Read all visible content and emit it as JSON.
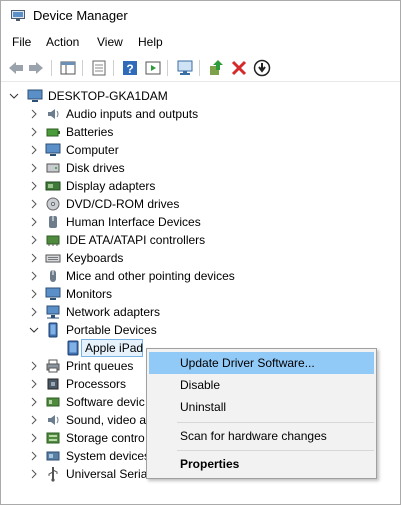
{
  "window": {
    "title": "Device Manager"
  },
  "menu": [
    "File",
    "Action",
    "View",
    "Help"
  ],
  "toolbar": {
    "buttons": [
      "back-icon",
      "forward-icon",
      "show-hide-tree-icon",
      "properties-icon",
      "help-icon",
      "action-pane-icon",
      "scan-hardware-icon",
      "update-driver-icon",
      "uninstall-icon",
      "disable-icon"
    ]
  },
  "tree": {
    "root": "DESKTOP-GKA1DAM",
    "categories": [
      {
        "label": "Audio inputs and outputs",
        "icon": "speaker-icon",
        "expanded": false
      },
      {
        "label": "Batteries",
        "icon": "battery-icon",
        "expanded": false
      },
      {
        "label": "Computer",
        "icon": "monitor-icon",
        "expanded": false
      },
      {
        "label": "Disk drives",
        "icon": "disk-drive-icon",
        "expanded": false
      },
      {
        "label": "Display adapters",
        "icon": "display-adapter-icon",
        "expanded": false
      },
      {
        "label": "DVD/CD-ROM drives",
        "icon": "dvd-icon",
        "expanded": false
      },
      {
        "label": "Human Interface Devices",
        "icon": "hid-icon",
        "expanded": false
      },
      {
        "label": "IDE ATA/ATAPI controllers",
        "icon": "ide-icon",
        "expanded": false
      },
      {
        "label": "Keyboards",
        "icon": "keyboard-icon",
        "expanded": false
      },
      {
        "label": "Mice and other pointing devices",
        "icon": "mouse-icon",
        "expanded": false
      },
      {
        "label": "Monitors",
        "icon": "monitor-icon",
        "expanded": false
      },
      {
        "label": "Network adapters",
        "icon": "network-icon",
        "expanded": false
      },
      {
        "label": "Portable Devices",
        "icon": "portable-device-icon",
        "expanded": true
      },
      {
        "label": "Print queues",
        "icon": "printer-icon",
        "expanded": false
      },
      {
        "label": "Processors",
        "icon": "processor-icon",
        "expanded": false
      },
      {
        "label": "Software devic",
        "icon": "software-device-icon",
        "expanded": false
      },
      {
        "label": "Sound, video a",
        "icon": "sound-icon",
        "expanded": false
      },
      {
        "label": "Storage contro",
        "icon": "storage-icon",
        "expanded": false
      },
      {
        "label": "System devices",
        "icon": "system-icon",
        "expanded": false
      },
      {
        "label": "Universal Serial",
        "icon": "usb-icon",
        "expanded": false
      }
    ],
    "selected_device": "Apple iPad"
  },
  "context_menu": {
    "update": "Update Driver Software...",
    "disable": "Disable",
    "uninstall": "Uninstall",
    "scan": "Scan for hardware changes",
    "properties": "Properties"
  },
  "colors": {
    "accent": "#0078d7",
    "highlight": "#91c9f7",
    "menu_bg": "#f2f2f2"
  }
}
